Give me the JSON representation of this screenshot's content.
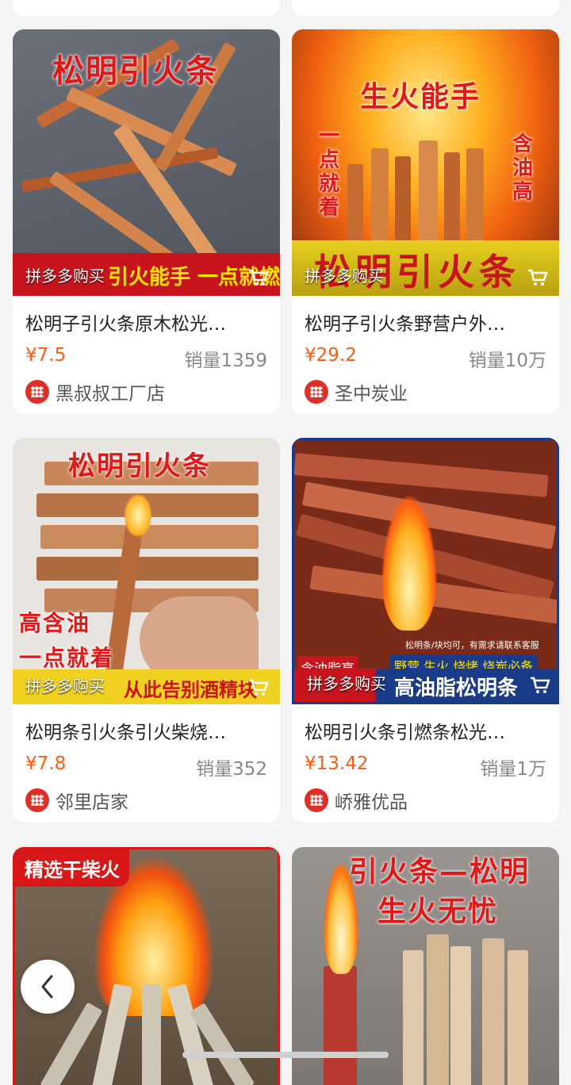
{
  "pinduoduo_label": "拼多多购买",
  "products": [
    {
      "title": "松明子引火条原木松光…",
      "price": "¥7.5",
      "sales": "销量1359",
      "store": "黑叔叔工厂店",
      "overlay_top": "松明引火条",
      "overlay_bottom": "引火能手  一点就燃"
    },
    {
      "title": "松明子引火条野营户外…",
      "price": "¥29.2",
      "sales": "销量10万",
      "store": "圣中炭业",
      "overlay_top": "生火能手",
      "overlay_left": "一点就着",
      "overlay_right": "含油高",
      "overlay_bottom": "松明引火条"
    },
    {
      "title": "松明条引火条引火柴烧…",
      "price": "¥7.8",
      "sales": "销量352",
      "store": "邻里店家",
      "overlay_top": "松明引火条",
      "overlay_mid1": "高含油",
      "overlay_mid2": "一点就着",
      "overlay_bottom": "从此告别酒精块"
    },
    {
      "title": "松明引火条引燃条松光…",
      "price": "¥13.42",
      "sales": "销量1万",
      "store": "峤雅优品",
      "overlay_small": "松明条/块均可，有需求请联系客服",
      "overlay_tags": "野营 生火 烧烤 烧炭必备",
      "overlay_left": "含油脂高",
      "overlay_bottom": "高油脂松明条"
    },
    {
      "overlay_top": "精选干柴火"
    },
    {
      "overlay_top": "引火条—松明",
      "overlay_mid": "生火无忧"
    }
  ],
  "back_icon": "chevron-left-icon",
  "colors": {
    "price": "#ff5a10",
    "brand": "#e02e24"
  }
}
